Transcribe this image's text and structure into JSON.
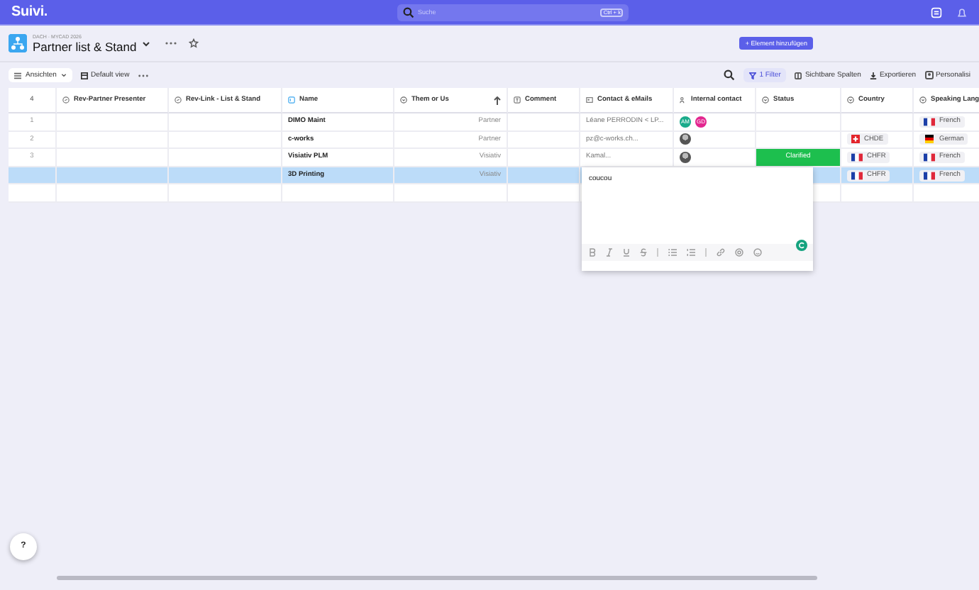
{
  "topbar": {
    "logo": "Suivi.",
    "search": {
      "placeholder": "Suche",
      "shortcut": "Ctrl + k"
    }
  },
  "header": {
    "breadcrumb": "DACH · MYCAD 2026",
    "title": "Partner list & Stand",
    "add_button": "+ Element hinzufügen"
  },
  "toolbar": {
    "views": "Ansichten",
    "view": "Default view",
    "filter": "1 Filter",
    "actions": [
      "Sichtbare Spalten",
      "Exportieren",
      "Personalisi"
    ]
  },
  "table": {
    "count": "4",
    "columns": [
      {
        "label": "Rev-Partner Presenter",
        "kind": "link"
      },
      {
        "label": "Rev-Link - List & Stand",
        "kind": "link"
      },
      {
        "label": "Name",
        "kind": "title"
      },
      {
        "label": "Them or Us",
        "kind": "select"
      },
      {
        "label": "Comment",
        "kind": "text"
      },
      {
        "label": "Contact & eMails",
        "kind": "contact"
      },
      {
        "label": "Internal contact",
        "kind": "user"
      },
      {
        "label": "Status",
        "kind": "select"
      },
      {
        "label": "Country",
        "kind": "select"
      },
      {
        "label": "Speaking Lang",
        "kind": "select"
      }
    ],
    "rows": [
      {
        "index": "1",
        "selected": false,
        "name": "DIMO Maint",
        "them_or_us": "Partner",
        "contact": "Léane PERRODIN < LP...",
        "internal_contact": [
          {
            "kind": "initials",
            "text": "AM",
            "color": "#1aab8b"
          },
          {
            "kind": "initials",
            "text": "GD",
            "color": "#e3268f"
          }
        ],
        "speaking_language": {
          "kind": "france",
          "label": "French"
        }
      },
      {
        "index": "2",
        "selected": false,
        "name": "c-works",
        "them_or_us": "Partner",
        "contact": "pz@c-works.ch...",
        "internal_contact": [
          {
            "kind": "photo"
          }
        ],
        "country": {
          "kind": "switzerland",
          "label": "CHDE"
        },
        "speaking_language": {
          "kind": "germany",
          "label": "German"
        }
      },
      {
        "index": "3",
        "selected": false,
        "name": "Visiativ PLM",
        "them_or_us": "Visiativ",
        "contact": "Kamal...",
        "internal_contact": [
          {
            "kind": "photo"
          }
        ],
        "status": {
          "label": "Clarified",
          "color": "#1dbf4e"
        },
        "country": {
          "kind": "france",
          "label": "CHFR"
        },
        "speaking_language": {
          "kind": "france",
          "label": "French"
        }
      },
      {
        "selected": true,
        "name": "3D Printing",
        "them_or_us": "Visiativ",
        "country": {
          "kind": "france",
          "label": "CHFR"
        },
        "speaking_language": {
          "kind": "france",
          "label": "French"
        }
      }
    ]
  },
  "editor": {
    "value": "coucou"
  },
  "help_button": "?"
}
